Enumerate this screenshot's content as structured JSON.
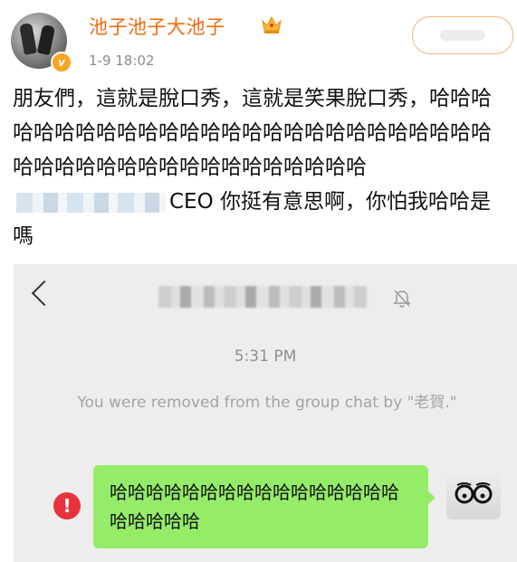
{
  "post": {
    "username": "池子池子大池子",
    "timestamp": "1-9 18:02",
    "text_before": "朋友們，這就是脫口秀，這就是笑果脫口秀，哈哈哈哈哈哈哈哈哈哈哈哈哈哈哈哈哈哈哈哈哈哈哈哈哈哈哈哈哈哈哈哈哈哈哈哈哈哈哈哈哈哈哈",
    "text_after": "CEO 你挺有意思啊，你怕我哈哈是嗎"
  },
  "chat": {
    "time": "5:31 PM",
    "system_message": "You were removed from the group chat by \"老賀.\"",
    "bubble_text": "哈哈哈哈哈哈哈哈哈哈哈哈哈哈哈哈哈哈哈哈哈",
    "error_symbol": "!"
  },
  "colors": {
    "username": "#f26b0f",
    "bubble": "#95ec69",
    "error": "#e8333c",
    "chat_bg": "#ededed"
  },
  "icons": [
    "avatar-image",
    "verified-badge-icon",
    "crown-badge-icon",
    "back-arrow-icon",
    "mute-bell-icon",
    "error-icon"
  ]
}
